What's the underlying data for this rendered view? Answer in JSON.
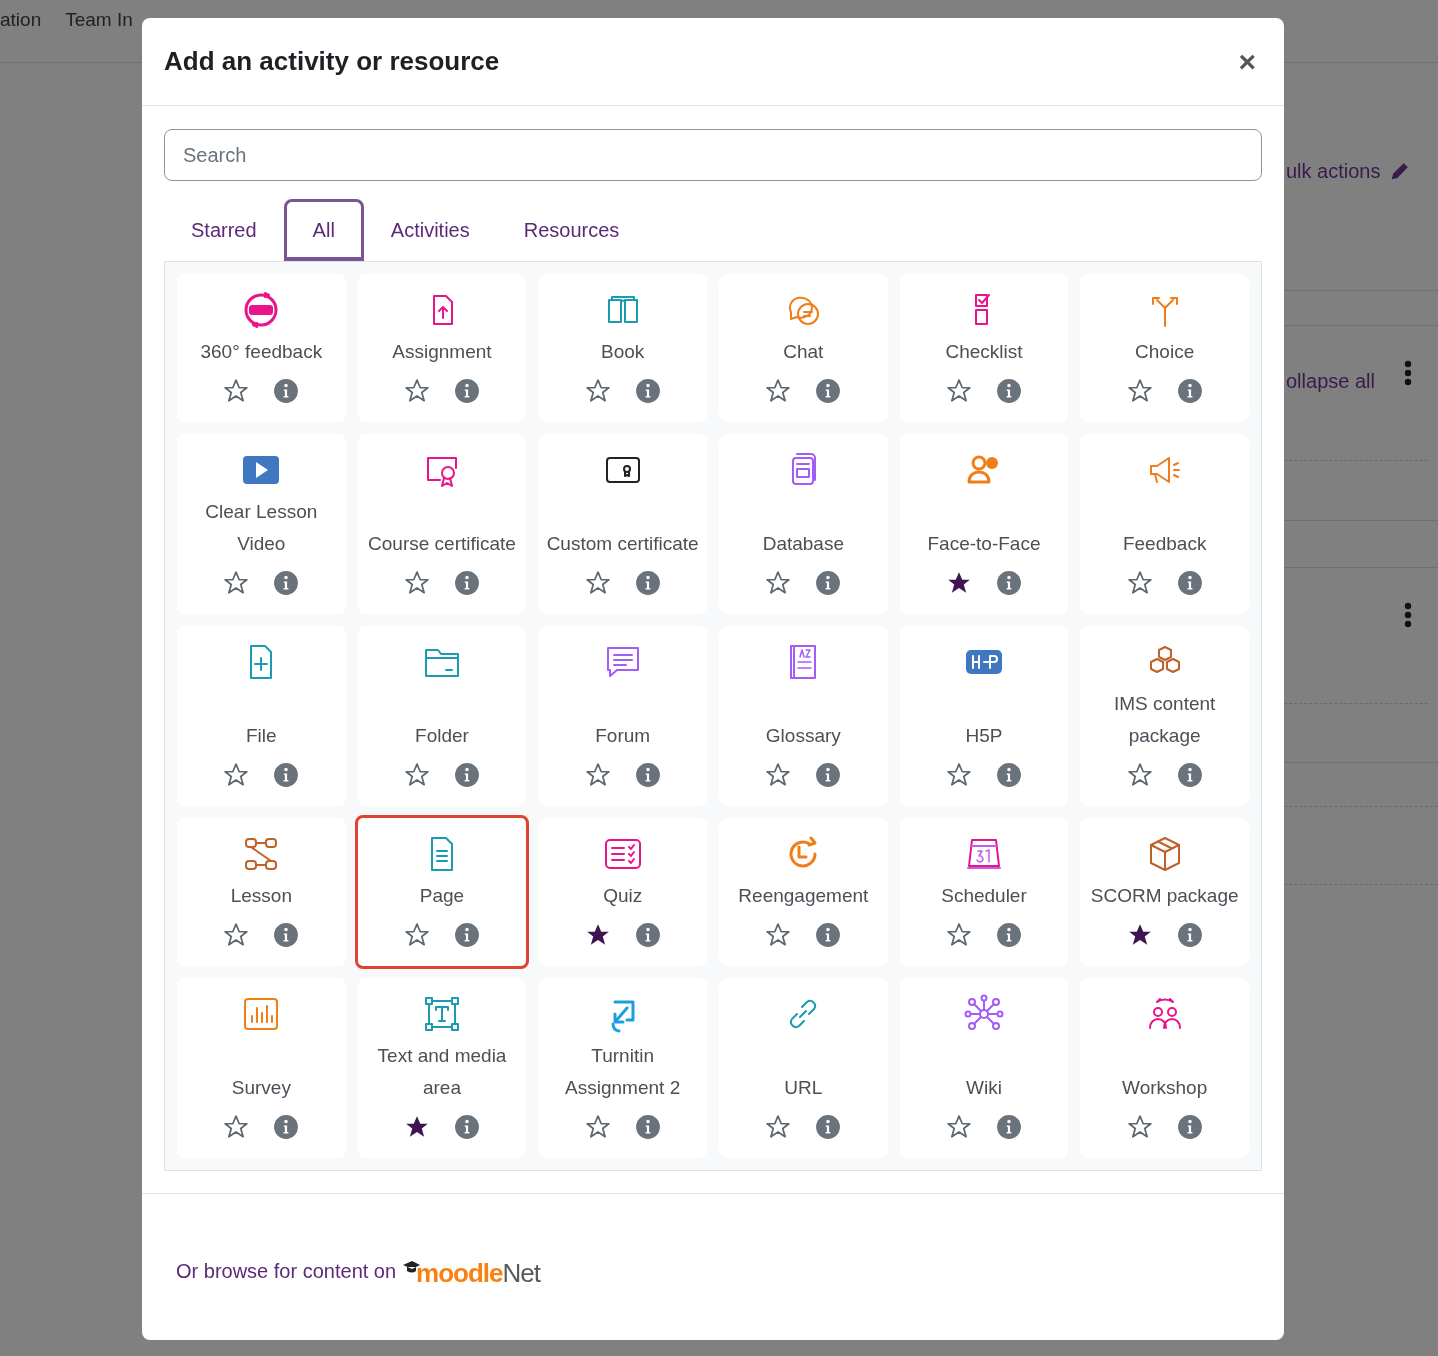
{
  "background": {
    "nav": [
      "ation",
      "Team In"
    ],
    "bulk_actions": "ulk actions",
    "collapse_all": "ollapse all"
  },
  "dialog": {
    "title": "Add an activity or resource",
    "close": "×",
    "search": {
      "placeholder": "Search"
    },
    "tabs": [
      {
        "label": "Starred",
        "selected": false
      },
      {
        "label": "All",
        "selected": true
      },
      {
        "label": "Activities",
        "selected": false
      },
      {
        "label": "Resources",
        "selected": false
      }
    ],
    "items": [
      {
        "label": "360° feedback",
        "starred": false,
        "selected": false
      },
      {
        "label": "Assignment",
        "starred": false,
        "selected": false
      },
      {
        "label": "Book",
        "starred": false,
        "selected": false
      },
      {
        "label": "Chat",
        "starred": false,
        "selected": false
      },
      {
        "label": "Checklist",
        "starred": false,
        "selected": false
      },
      {
        "label": "Choice",
        "starred": false,
        "selected": false
      },
      {
        "label": "Clear Lesson Video",
        "starred": false,
        "selected": false
      },
      {
        "label": "Course certificate",
        "starred": false,
        "selected": false
      },
      {
        "label": "Custom certificate",
        "starred": false,
        "selected": false
      },
      {
        "label": "Database",
        "starred": false,
        "selected": false
      },
      {
        "label": "Face-to-Face",
        "starred": true,
        "selected": false
      },
      {
        "label": "Feedback",
        "starred": false,
        "selected": false
      },
      {
        "label": "File",
        "starred": false,
        "selected": false
      },
      {
        "label": "Folder",
        "starred": false,
        "selected": false
      },
      {
        "label": "Forum",
        "starred": false,
        "selected": false
      },
      {
        "label": "Glossary",
        "starred": false,
        "selected": false
      },
      {
        "label": "H5P",
        "starred": false,
        "selected": false
      },
      {
        "label": "IMS content package",
        "starred": false,
        "selected": false
      },
      {
        "label": "Lesson",
        "starred": false,
        "selected": false
      },
      {
        "label": "Page",
        "starred": false,
        "selected": true
      },
      {
        "label": "Quiz",
        "starred": true,
        "selected": false
      },
      {
        "label": "Reengagement",
        "starred": false,
        "selected": false
      },
      {
        "label": "Scheduler",
        "starred": false,
        "selected": false
      },
      {
        "label": "SCORM package",
        "starred": true,
        "selected": false
      },
      {
        "label": "Survey",
        "starred": false,
        "selected": false
      },
      {
        "label": "Text and media area",
        "starred": true,
        "selected": false
      },
      {
        "label": "Turnitin Assignment 2",
        "starred": false,
        "selected": false
      },
      {
        "label": "URL",
        "starred": false,
        "selected": false
      },
      {
        "label": "Wiki",
        "starred": false,
        "selected": false
      },
      {
        "label": "Workshop",
        "starred": false,
        "selected": false
      }
    ],
    "footer": {
      "text": "Or browse for content on",
      "logo": {
        "main": "moodle",
        "suffix": "Net"
      }
    }
  }
}
